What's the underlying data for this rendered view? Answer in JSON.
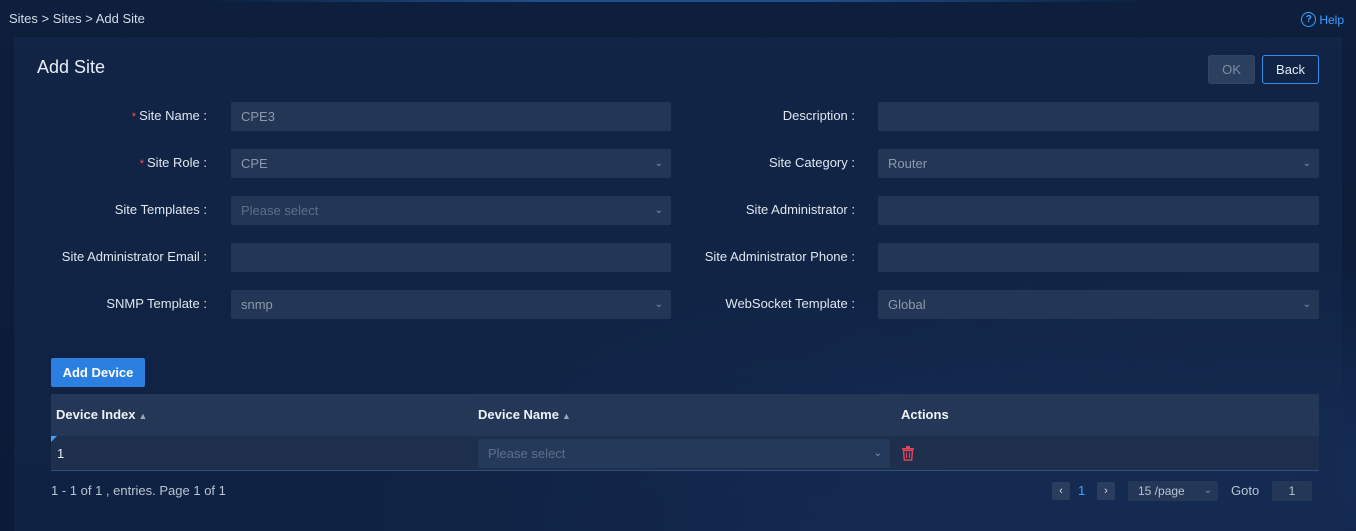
{
  "breadcrumb": "Sites > Sites > Add Site",
  "help_label": "Help",
  "page_title": "Add Site",
  "buttons": {
    "ok": "OK",
    "back": "Back",
    "add_device": "Add Device"
  },
  "form": {
    "site_name": {
      "label": "Site Name :",
      "value": "CPE3",
      "required": true
    },
    "description": {
      "label": "Description :",
      "value": ""
    },
    "site_role": {
      "label": "Site Role :",
      "value": "CPE",
      "required": true
    },
    "site_category": {
      "label": "Site Category :",
      "value": "Router"
    },
    "site_templates": {
      "label": "Site Templates :",
      "placeholder": "Please select"
    },
    "site_administrator": {
      "label": "Site Administrator :",
      "value": ""
    },
    "site_admin_email": {
      "label": "Site Administrator Email :",
      "value": ""
    },
    "site_admin_phone": {
      "label": "Site Administrator Phone :",
      "value": ""
    },
    "snmp_template": {
      "label": "SNMP Template :",
      "value": "snmp"
    },
    "websocket_template": {
      "label": "WebSocket Template :",
      "value": "Global"
    }
  },
  "table": {
    "columns": [
      "Device Index",
      "Device Name",
      "Actions"
    ],
    "rows": [
      {
        "index": "1",
        "device_name_placeholder": "Please select"
      }
    ]
  },
  "pagination": {
    "summary": "1 - 1 of 1 , entries. Page 1 of 1",
    "current_page": "1",
    "page_size": "15 /page",
    "goto_label": "Goto",
    "goto_value": "1"
  },
  "colors": {
    "accent": "#2a7fe0",
    "link": "#3ea0ff",
    "required": "#ff4d5a",
    "delete": "#e0435a"
  }
}
